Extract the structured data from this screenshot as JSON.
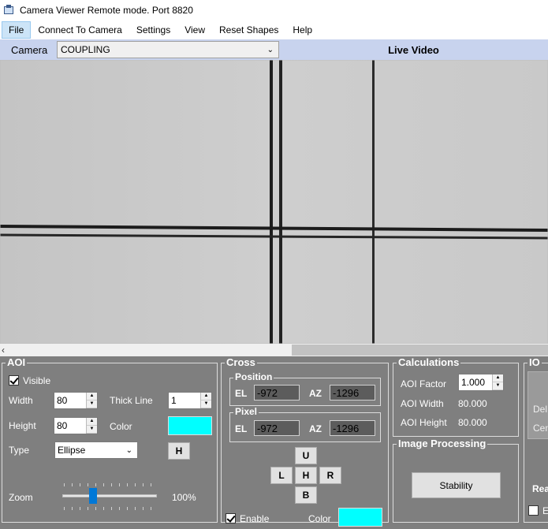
{
  "window": {
    "title": "Camera Viewer Remote mode. Port 8820"
  },
  "menu": {
    "items": [
      "File",
      "Connect To Camera",
      "Settings",
      "View",
      "Reset Shapes",
      "Help"
    ]
  },
  "camera_bar": {
    "label": "Camera",
    "selected": "COUPLING",
    "live_video": "Live Video"
  },
  "aoi": {
    "title": "AOI",
    "visible_label": "Visible",
    "width_label": "Width",
    "width_value": "80",
    "height_label": "Height",
    "height_value": "80",
    "thick_line_label": "Thick Line",
    "thick_line_value": "1",
    "color_label": "Color",
    "color": "#00ffff",
    "type_label": "Type",
    "type_value": "Ellipse",
    "h_button": "H",
    "zoom_label": "Zoom",
    "zoom_value": "100%"
  },
  "cross": {
    "title": "Cross",
    "position_title": "Position",
    "pos_el_label": "EL",
    "pos_el_value": "-972",
    "pos_az_label": "AZ",
    "pos_az_value": "-1296",
    "pixel_title": "Pixel",
    "pix_el_label": "EL",
    "pix_el_value": "-972",
    "pix_az_label": "AZ",
    "pix_az_value": "-1296",
    "btn_u": "U",
    "btn_l": "L",
    "btn_h": "H",
    "btn_r": "R",
    "btn_b": "B",
    "enable_label": "Enable",
    "color_label": "Color",
    "color": "#00ffff"
  },
  "calculations": {
    "title": "Calculations",
    "aoi_factor_label": "AOI Factor",
    "aoi_factor_value": "1.000",
    "aoi_width_label": "AOI Width",
    "aoi_width_value": "80.000",
    "aoi_height_label": "AOI Height",
    "aoi_height_value": "80.000"
  },
  "image_processing": {
    "title": "Image Processing",
    "stability_button": "Stability"
  },
  "io": {
    "title": "IO",
    "del_label": "Del",
    "cen_label": "Cen",
    "rea_label": "Rea",
    "e_label": "E"
  }
}
